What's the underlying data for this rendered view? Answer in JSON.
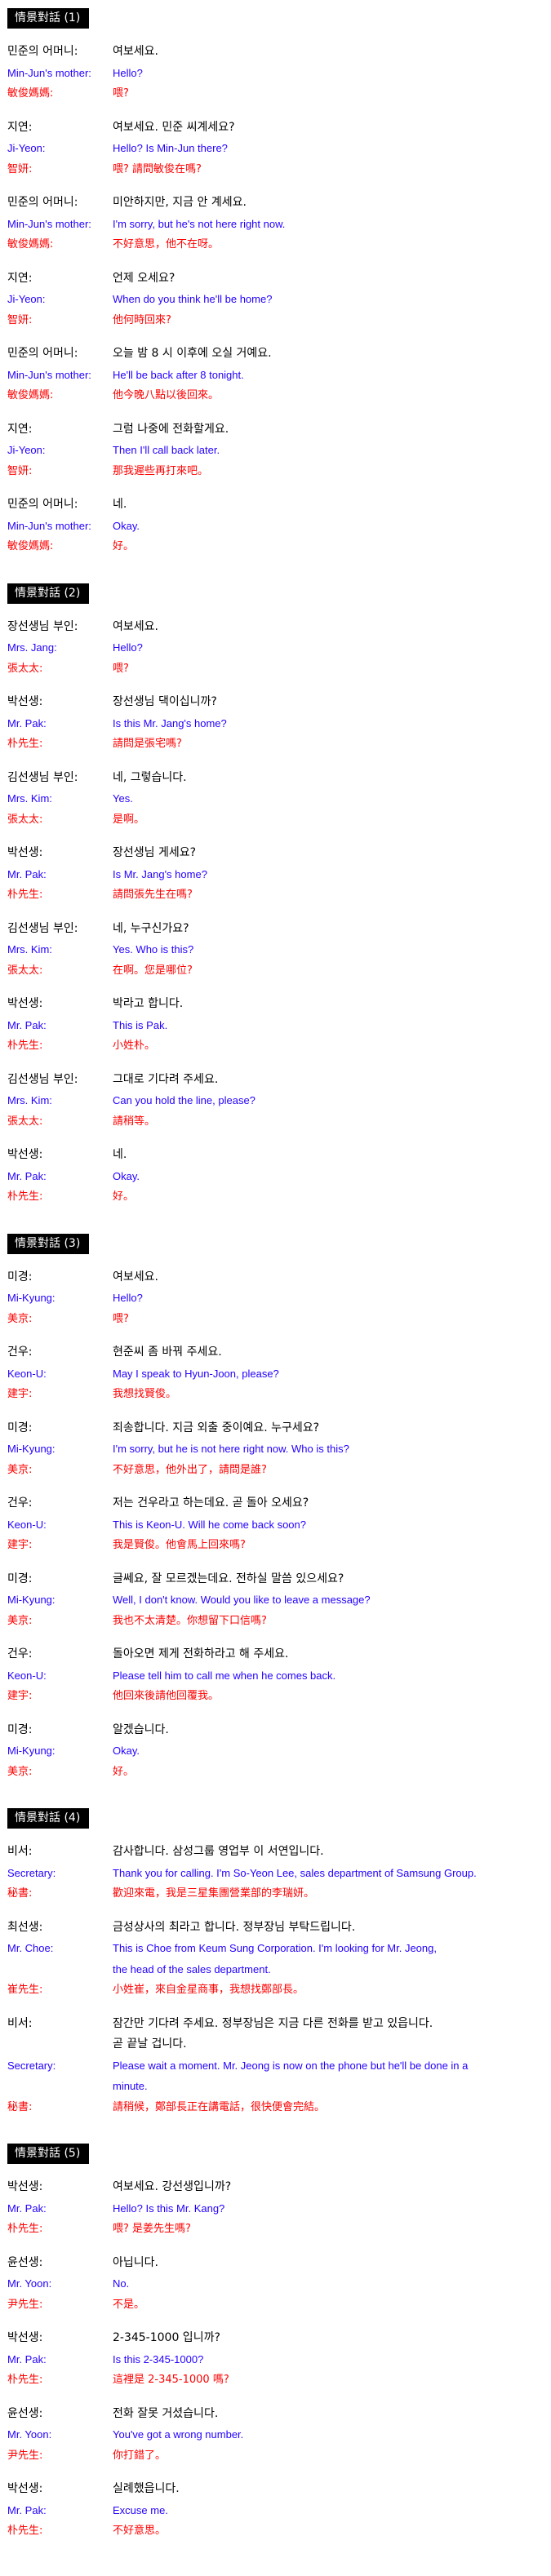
{
  "colors": {
    "korean": "#000000",
    "english": "#2200ff",
    "chinese": "#ff0000",
    "header_bg": "#000000"
  },
  "sections": [
    {
      "title": "情景對話 (1)",
      "entries": [
        {
          "ko_speaker": "민준의 어머니:",
          "ko": [
            "여보세요."
          ],
          "en_speaker": "Min-Jun's mother:",
          "en": [
            "Hello?"
          ],
          "zh_speaker": "敏俊媽媽:",
          "zh": "喂?"
        },
        {
          "ko_speaker": "지연:",
          "ko": [
            "여보세요. 민준 씨계세요?"
          ],
          "en_speaker": "Ji-Yeon:",
          "en": [
            "Hello? Is Min-Jun there?"
          ],
          "zh_speaker": "智妍:",
          "zh": "喂? 請問敏俊在嗎?"
        },
        {
          "ko_speaker": "민준의 어머니:",
          "ko": [
            "미안하지만, 지금 안 계세요."
          ],
          "en_speaker": "Min-Jun's mother:",
          "en": [
            "I'm sorry, but he's not here right now."
          ],
          "zh_speaker": "敏俊媽媽:",
          "zh": "不好意思，他不在呀。"
        },
        {
          "ko_speaker": "지연:",
          "ko": [
            "언제 오세요?"
          ],
          "en_speaker": "Ji-Yeon:",
          "en": [
            "When do you think he'll be home?"
          ],
          "zh_speaker": "智妍:",
          "zh": "他何時回來?"
        },
        {
          "ko_speaker": "민준의 어머니:",
          "ko": [
            "오늘 밤 8 시 이후에 오실 거예요."
          ],
          "en_speaker": "Min-Jun's mother:",
          "en": [
            "He'll be back after 8 tonight."
          ],
          "zh_speaker": "敏俊媽媽:",
          "zh": "他今晚八點以後回來。"
        },
        {
          "ko_speaker": "지연:",
          "ko": [
            "그럼 나중에 전화할게요."
          ],
          "en_speaker": "Ji-Yeon:",
          "en": [
            "Then I'll call back later."
          ],
          "zh_speaker": "智妍:",
          "zh": "那我遲些再打來吧。"
        },
        {
          "ko_speaker": "민준의 어머니:",
          "ko": [
            "네."
          ],
          "en_speaker": "Min-Jun's mother:",
          "en": [
            "Okay."
          ],
          "zh_speaker": "敏俊媽媽:",
          "zh": "好。"
        }
      ]
    },
    {
      "title": "情景對話 (2)",
      "entries": [
        {
          "ko_speaker": "장선생님 부인:",
          "ko": [
            "여보세요."
          ],
          "en_speaker": "Mrs. Jang:",
          "en": [
            "Hello?"
          ],
          "zh_speaker": "張太太:",
          "zh": "喂?"
        },
        {
          "ko_speaker": "박선생:",
          "ko": [
            "장선생님 댁이십니까?"
          ],
          "en_speaker": "Mr. Pak:",
          "en": [
            "Is this Mr. Jang's home?"
          ],
          "zh_speaker": "朴先生:",
          "zh": "請問是張宅嗎?"
        },
        {
          "ko_speaker": "김선생님 부인:",
          "ko": [
            "네, 그렇습니다."
          ],
          "en_speaker": "Mrs. Kim:",
          "en": [
            "Yes."
          ],
          "zh_speaker": "張太太:",
          "zh": "是啊。"
        },
        {
          "ko_speaker": "박선생:",
          "ko": [
            "장선생님 게세요?"
          ],
          "en_speaker": "Mr. Pak:",
          "en": [
            "Is Mr. Jang's home?"
          ],
          "zh_speaker": "朴先生:",
          "zh": "請問張先生在嗎?"
        },
        {
          "ko_speaker": "김선생님 부인:",
          "ko": [
            "네, 누구신가요?"
          ],
          "en_speaker": "Mrs. Kim:",
          "en": [
            "Yes.   Who is this?"
          ],
          "zh_speaker": "張太太:",
          "zh": "在啊。您是哪位?"
        },
        {
          "ko_speaker": "박선생:",
          "ko": [
            "박라고 합니다."
          ],
          "en_speaker": "Mr. Pak:",
          "en": [
            "This is Pak."
          ],
          "zh_speaker": "朴先生:",
          "zh": "小姓朴。"
        },
        {
          "ko_speaker": "김선생님 부인:",
          "ko": [
            "그대로 기다려 주세요."
          ],
          "en_speaker": "Mrs. Kim:",
          "en": [
            "Can you hold the line, please?"
          ],
          "zh_speaker": "張太太:",
          "zh": "請稍等。"
        },
        {
          "ko_speaker": "박선생:",
          "ko": [
            "네."
          ],
          "en_speaker": "Mr. Pak:",
          "en": [
            "Okay."
          ],
          "zh_speaker": "朴先生:",
          "zh": "好。"
        }
      ]
    },
    {
      "title": "情景對話 (3)",
      "entries": [
        {
          "ko_speaker": "미경:",
          "ko": [
            "여보세요."
          ],
          "en_speaker": "Mi-Kyung:",
          "en": [
            "Hello?"
          ],
          "zh_speaker": "美京:",
          "zh": "喂?"
        },
        {
          "ko_speaker": "건우:",
          "ko": [
            "현준씨 좀 바꿔 주세요."
          ],
          "en_speaker": "Keon-U:",
          "en": [
            "May I speak to Hyun-Joon, please?"
          ],
          "zh_speaker": "建宇:",
          "zh": "我想找賢俊。"
        },
        {
          "ko_speaker": "미경:",
          "ko": [
            "죄송합니다. 지금 외출 중이예요.  누구세요?"
          ],
          "en_speaker": "Mi-Kyung:",
          "en": [
            "I'm sorry, but he is not here right now.   Who is this?"
          ],
          "zh_speaker": "美京:",
          "zh": "不好意思，他外出了，請問是誰?"
        },
        {
          "ko_speaker": "건우:",
          "ko": [
            "저는 건우라고 하는데요. 곧 돌아 오세요?"
          ],
          "en_speaker": "Keon-U:",
          "en": [
            "This is Keon-U.   Will he come back soon?"
          ],
          "zh_speaker": "建宇:",
          "zh": "我是賢俊。他會馬上回來嗎?"
        },
        {
          "ko_speaker": "미경:",
          "ko": [
            "글쎄요, 잘 모르겠는데요. 전하실 말씀 있으세요?"
          ],
          "en_speaker": "Mi-Kyung:",
          "en": [
            "Well, I don't know.   Would you like to leave a message?"
          ],
          "zh_speaker": "美京:",
          "zh": "我也不太清楚。你想留下口信嗎?"
        },
        {
          "ko_speaker": "건우:",
          "ko": [
            "돌아오면 제게 전화하라고 해 주세요."
          ],
          "en_speaker": "Keon-U:",
          "en": [
            "Please tell him to call me when he comes back."
          ],
          "zh_speaker": "建宇:",
          "zh": "他回來後請他回覆我。"
        },
        {
          "ko_speaker": "미경:",
          "ko": [
            "알겠습니다."
          ],
          "en_speaker": "Mi-Kyung:",
          "en": [
            "Okay."
          ],
          "zh_speaker": "美京:",
          "zh": "好。"
        }
      ]
    },
    {
      "title": "情景對話 (4)",
      "entries": [
        {
          "ko_speaker": "비서:",
          "ko": [
            "감사합니다.  삼성그룹 영업부 이 서연입니다."
          ],
          "en_speaker": "Secretary:",
          "en": [
            "Thank you for calling.   I'm So-Yeon Lee, sales department of Samsung Group."
          ],
          "zh_speaker": "秘書:",
          "zh": "歡迎來電，我是三星集團營業部的李瑞妍。"
        },
        {
          "ko_speaker": "최선생:",
          "ko": [
            "금성상사의 최라고 합니다. 정부장님 부탁드립니다."
          ],
          "en_speaker": "Mr. Choe:",
          "en": [
            "This is Choe from Keum Sung Corporation.   I'm looking for Mr. Jeong,",
            "the head of the sales department."
          ],
          "zh_speaker": "崔先生:",
          "zh": "小姓崔，來自金星商事，我想找鄭部長。"
        },
        {
          "ko_speaker": "비서:",
          "ko": [
            "잠간만 기다려 주세요.  정부장님은 지금 다른 전화를 받고 있읍니다.",
            "곧 끝날 겁니다."
          ],
          "en_speaker": "Secretary:",
          "en": [
            "Please wait a moment.   Mr. Jeong is now on the phone but he'll be done in a",
            "minute."
          ],
          "zh_speaker": "秘書:",
          "zh": "請稍候，鄭部長正在講電話，很快便會完結。"
        }
      ]
    },
    {
      "title": "情景對話 (5)",
      "entries": [
        {
          "ko_speaker": "박선생:",
          "ko": [
            "여보세요. 강선생입니까?"
          ],
          "en_speaker": "Mr. Pak:",
          "en": [
            "Hello?   Is this Mr. Kang?"
          ],
          "zh_speaker": "朴先生:",
          "zh": "喂? 是姜先生嗎?"
        },
        {
          "ko_speaker": "윤선생:",
          "ko": [
            "아닙니다."
          ],
          "en_speaker": "Mr. Yoon:",
          "en": [
            "No."
          ],
          "zh_speaker": "尹先生:",
          "zh": "不是。"
        },
        {
          "ko_speaker": "박선생:",
          "ko": [
            "2-345-1000 입니까?"
          ],
          "en_speaker": "Mr. Pak:",
          "en": [
            "Is this 2-345-1000?"
          ],
          "zh_speaker": "朴先生:",
          "zh": "這裡是 2-345-1000 嗎?"
        },
        {
          "ko_speaker": "윤선생:",
          "ko": [
            "전화 잘못 거셨습니다."
          ],
          "en_speaker": "Mr. Yoon:",
          "en": [
            "You've got a wrong number."
          ],
          "zh_speaker": "尹先生:",
          "zh": "你打錯了。"
        },
        {
          "ko_speaker": "박선생:",
          "ko": [
            "실례했읍니다."
          ],
          "en_speaker": "Mr. Pak:",
          "en": [
            "Excuse me."
          ],
          "zh_speaker": "朴先生:",
          "zh": "不好意思。"
        }
      ]
    }
  ]
}
